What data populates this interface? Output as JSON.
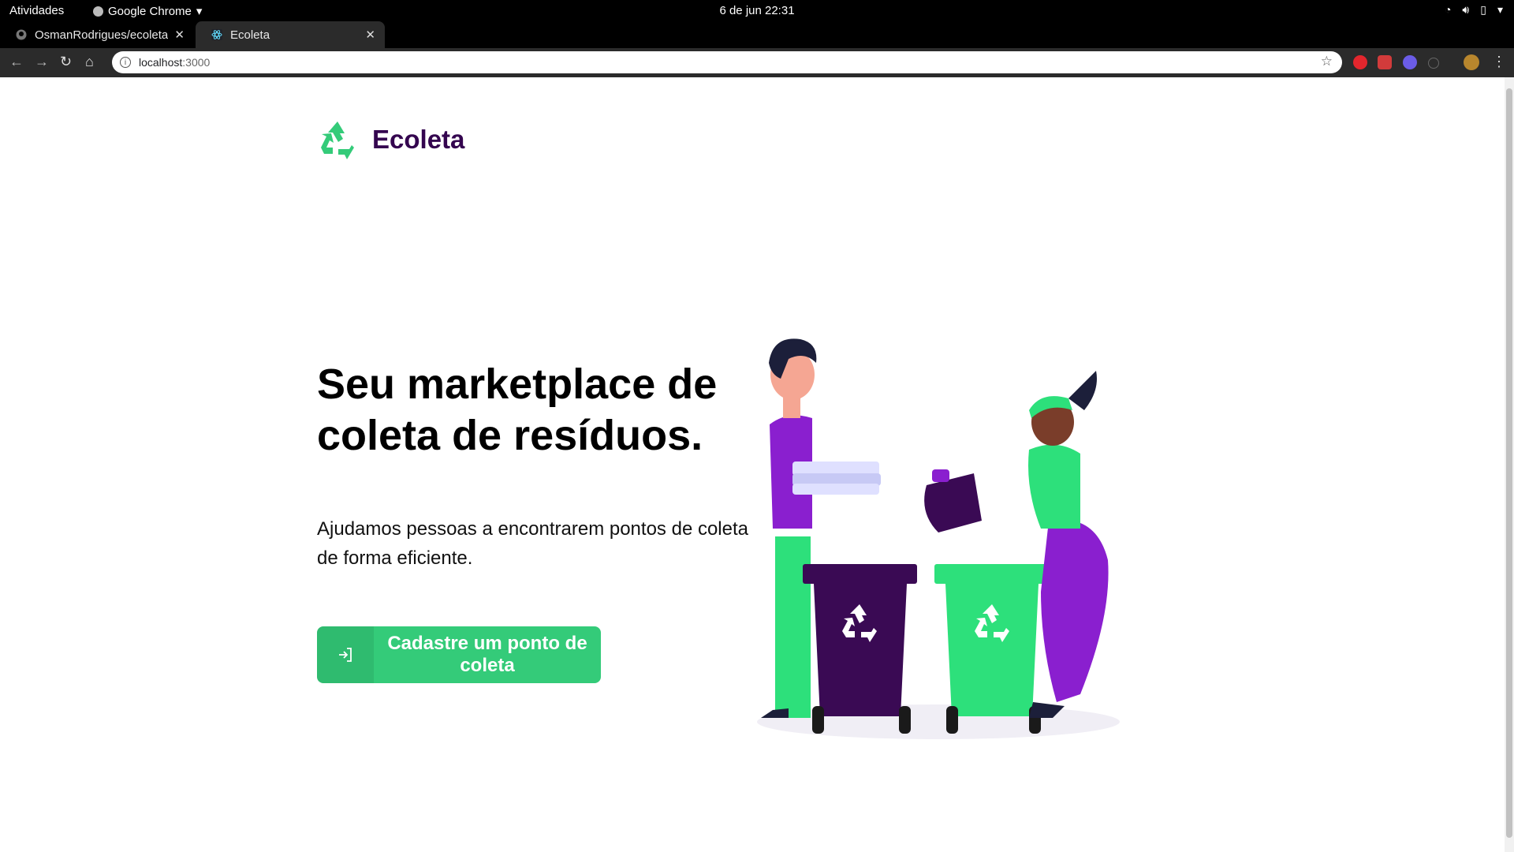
{
  "os_bar": {
    "activities": "Atividades",
    "app_name": "Google Chrome",
    "clock": "6 de jun  22:31"
  },
  "browser": {
    "tabs": [
      {
        "title": "OsmanRodrigues/ecoleta",
        "active": false
      },
      {
        "title": "Ecoleta",
        "active": true
      }
    ],
    "url_host": "localhost",
    "url_port": ":3000"
  },
  "page": {
    "brand": "Ecoleta",
    "headline": "Seu marketplace de coleta de resíduos.",
    "subtitle": "Ajudamos pessoas a encontrarem pontos de coleta de forma eficiente.",
    "cta_label": "Cadastre um ponto de coleta"
  },
  "colors": {
    "brand_purple": "#34054f",
    "primary_green": "#34cb79",
    "bin_green": "#2de07b",
    "bin_purple": "#3a0a54"
  }
}
